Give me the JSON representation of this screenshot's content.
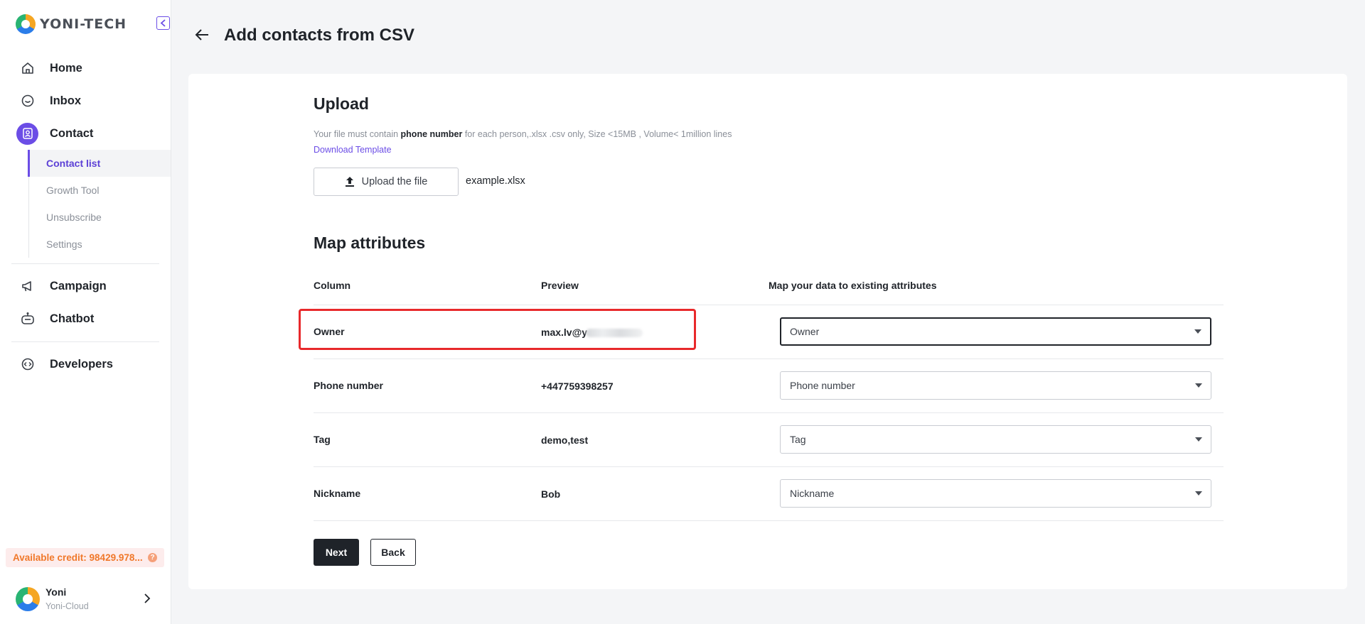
{
  "app": {
    "logo_text": "YONI-TECH"
  },
  "sidebar": {
    "nav": [
      {
        "label": "Home",
        "icon": "home-icon"
      },
      {
        "label": "Inbox",
        "icon": "chat-icon"
      },
      {
        "label": "Contact",
        "icon": "contact-icon",
        "active": true
      },
      {
        "label": "Campaign",
        "icon": "megaphone-icon"
      },
      {
        "label": "Chatbot",
        "icon": "robot-icon"
      },
      {
        "label": "Developers",
        "icon": "code-icon"
      }
    ],
    "contact_subnav": [
      {
        "label": "Contact list",
        "active": true
      },
      {
        "label": "Growth Tool"
      },
      {
        "label": "Unsubscribe"
      },
      {
        "label": "Settings"
      }
    ],
    "credit_text": "Available credit: 98429.978...",
    "user": {
      "name": "Yoni",
      "org": "Yoni-Cloud"
    }
  },
  "header": {
    "title": "Add contacts from CSV"
  },
  "upload": {
    "title": "Upload",
    "hint_prefix": "Your file must contain ",
    "hint_bold": "phone number",
    "hint_suffix": " for each person,.xlsx .csv only, Size <15MB , Volume< 1million lines",
    "template_link": "Download Template",
    "button_label": "Upload the file",
    "filename": "example.xlsx"
  },
  "map": {
    "title": "Map attributes",
    "headers": {
      "column": "Column",
      "preview": "Preview",
      "attribute": "Map your data to existing attributes"
    },
    "rows": [
      {
        "column": "Owner",
        "preview": "max.lv@y",
        "attribute": "Owner"
      },
      {
        "column": "Phone number",
        "preview": "+447759398257",
        "attribute": "Phone number"
      },
      {
        "column": "Tag",
        "preview": "demo,test",
        "attribute": "Tag"
      },
      {
        "column": "Nickname",
        "preview": "Bob",
        "attribute": "Nickname"
      }
    ]
  },
  "actions": {
    "next_label": "Next",
    "back_label": "Back"
  },
  "colors": {
    "accent": "#6b4de6",
    "highlight": "#e8292b",
    "credit_text": "#f0782a",
    "primary_button": "#1f2329"
  }
}
